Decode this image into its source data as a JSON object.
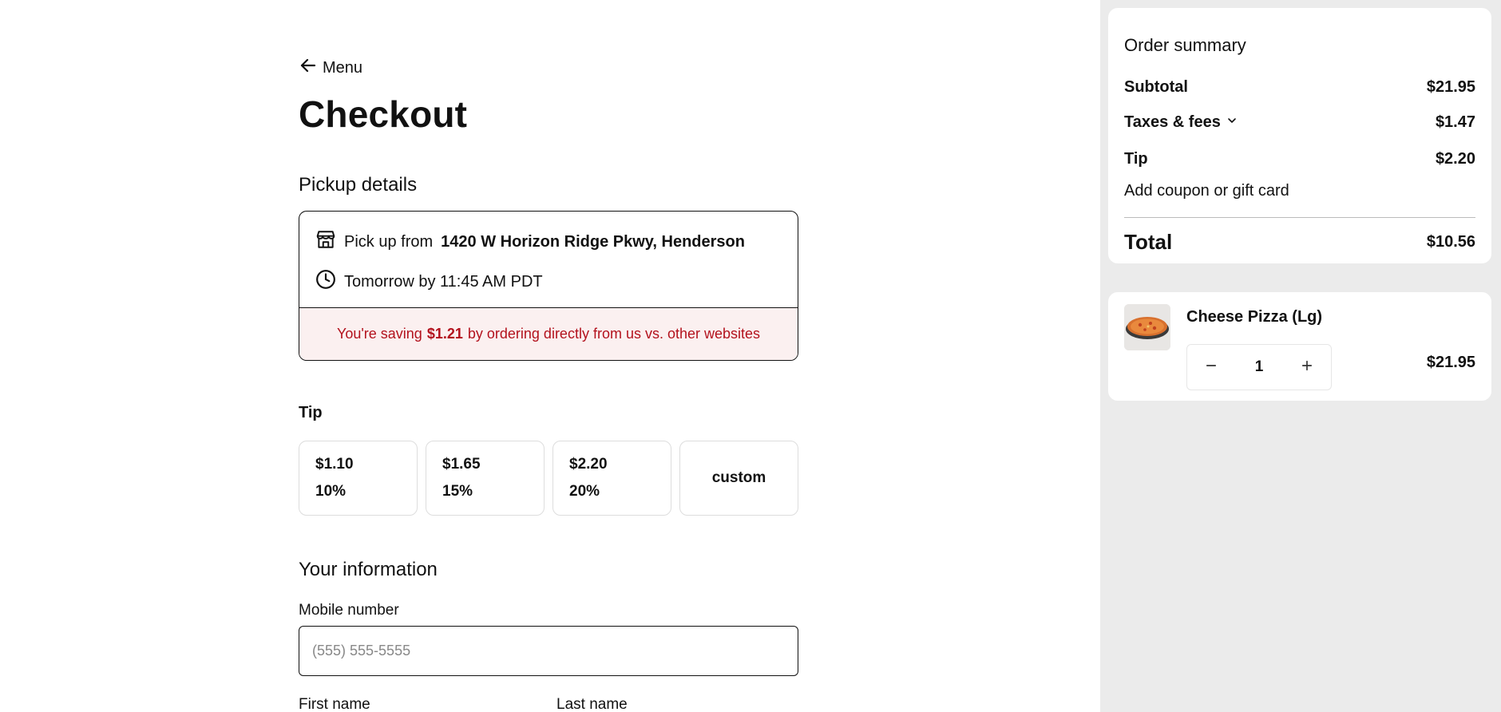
{
  "nav": {
    "back_label": "Menu"
  },
  "page": {
    "title": "Checkout"
  },
  "pickup": {
    "section_title": "Pickup details",
    "prefix": "Pick up from",
    "address": "1420 W Horizon Ridge Pkwy, Henderson",
    "time": "Tomorrow by 11:45 AM PDT",
    "saving_prefix": "You're saving",
    "saving_amount": "$1.21",
    "saving_suffix": "by ordering directly from us vs. other websites"
  },
  "tip": {
    "title": "Tip",
    "options": [
      {
        "amount": "$1.10",
        "percent": "10%"
      },
      {
        "amount": "$1.65",
        "percent": "15%"
      },
      {
        "amount": "$2.20",
        "percent": "20%"
      }
    ],
    "custom_label": "custom"
  },
  "info": {
    "title": "Your information",
    "mobile_label": "Mobile number",
    "mobile_placeholder": "(555) 555-5555",
    "mobile_value": "",
    "first_name_label": "First name",
    "last_name_label": "Last name"
  },
  "summary": {
    "title": "Order summary",
    "subtotal_label": "Subtotal",
    "subtotal_value": "$21.95",
    "taxes_label": "Taxes & fees",
    "taxes_value": "$1.47",
    "tip_label": "Tip",
    "tip_value": "$2.20",
    "coupon_label": "Add coupon or gift card",
    "total_label": "Total",
    "total_value": "$10.56"
  },
  "cart": {
    "item_name": "Cheese Pizza (Lg)",
    "quantity": "1",
    "price": "$21.95"
  },
  "colors": {
    "saving_text": "#b3121d",
    "saving_bg": "#fbf0f0",
    "sidebar_bg": "#ebebeb"
  },
  "icons": [
    "arrow-left-icon",
    "store-icon",
    "clock-icon",
    "chevron-down-icon",
    "minus-icon",
    "plus-icon"
  ]
}
